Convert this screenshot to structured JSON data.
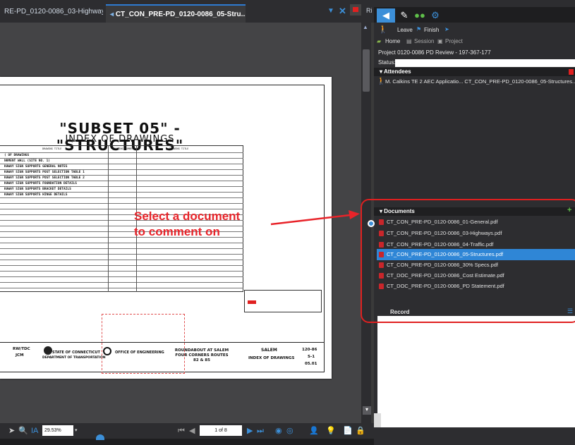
{
  "tabs": {
    "tab1": "RE-PD_0120-0086_03-Highways",
    "tab2": "CT_CON_PRE-PD_0120-0086_05-Stru...",
    "tab3": "Ri"
  },
  "document": {
    "title": "\"SUBSET 05\" - \"STRUCTURES\"",
    "subtitle": "INDEX OF DRAWINGS",
    "head_col1": "DRAWING TITLE",
    "head_col2": "DRAWING NUMBER",
    "head_col3": "DRAWING TITLE",
    "rows": [
      "( OF DRAWINGS",
      "NKMENT WALL (SITE NO. 1)",
      "KAWAY SIGN SUPPORTS GENERAL NOTES",
      "KAWAY SIGN SUPPORTS POST SELECTION TABLE 1",
      "KAWAY SIGN SUPPORTS POST SELECTION TABLE 2",
      "KAWAY SIGN SUPPORTS FOUNDATION DETAILS",
      "KAWAY SIGN SUPPORTS BRACKET DETAILS",
      "KAWAY SIGN SUPPORTS HINGE DETAILS"
    ],
    "tb_state": "STATE OF CONNECTICUT",
    "tb_dept": "DEPARTMENT OF TRANSPORTATION",
    "tb_office": "OFFICE OF ENGINEERING",
    "tb_project": "ROUNDABOUT AT SALEM FOUR CORNERS ROUTES 82 & 85",
    "tb_town": "SALEM",
    "tb_sheet": "INDEX OF DRAWINGS",
    "tb_no1": "120-86",
    "tb_no2": "S-1",
    "tb_no3": "05.01",
    "tb_init1": "RW/TDC",
    "tb_init2": "JCM"
  },
  "annotation": {
    "line1": "Select a document",
    "line2": "to comment on"
  },
  "bottom": {
    "zoom": "29.53%",
    "page": "1 of 8"
  },
  "right": {
    "leave": "Leave",
    "finish": "Finish",
    "home": "Home",
    "session": "Session",
    "project_lbl": "Project",
    "project": "Project 0120-0086 PD Review - 197-367-177",
    "status": "Status:",
    "attendees": "Attendees",
    "attendee": "M. Calkins TE 2 AEC Applicatio...   CT_CON_PRE-PD_0120-0086_05-Structures...",
    "documents": "Documents",
    "record": "Record",
    "docs": [
      "CT_CON_PRE-PD_0120-0086_01-General.pdf",
      "CT_CON_PRE-PD_0120-0086_03-Highways.pdf",
      "CT_CON_PRE-PD_0120-0086_04-Traffic.pdf",
      "CT_CON_PRE-PD_0120-0086_05-Structures.pdf",
      "CT_CON_PRE-PD_0120-0086_30% Specs.pdf",
      "CT_DOC_PRE-PD_0120-0086_Cost Estimate.pdf",
      "CT_DOC_PRE-PD_0120-0086_PD Statement.pdf"
    ]
  },
  "colors": {
    "accent": "#2f86d6",
    "annotation": "#e8242a"
  }
}
